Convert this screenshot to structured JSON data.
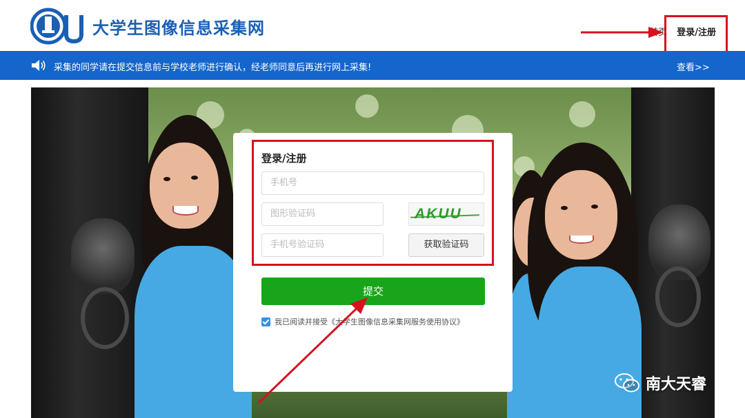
{
  "header": {
    "logo_text": "大学生图像信息采集网",
    "nav_home": "首页",
    "nav_login": "登录/注册"
  },
  "notice": {
    "text": "采集的同学请在提交信息前与学校老师进行确认，经老师同意后再进行网上采集!",
    "more": "查看>>"
  },
  "login": {
    "title": "登录/注册",
    "phone_placeholder": "手机号",
    "image_code_placeholder": "图形验证码",
    "captcha_text": "AKUU",
    "sms_code_placeholder": "手机号验证码",
    "get_code_button": "获取验证码",
    "submit_button": "提交",
    "agree_text": "我已阅读并接受《大学生图像信息采集网服务使用协议》",
    "agree_checked": true
  },
  "watermark": {
    "text": "南大天睿"
  },
  "colors": {
    "brand_blue": "#1466cc",
    "submit_green": "#18a51c",
    "annotation_red": "#d7111d"
  }
}
